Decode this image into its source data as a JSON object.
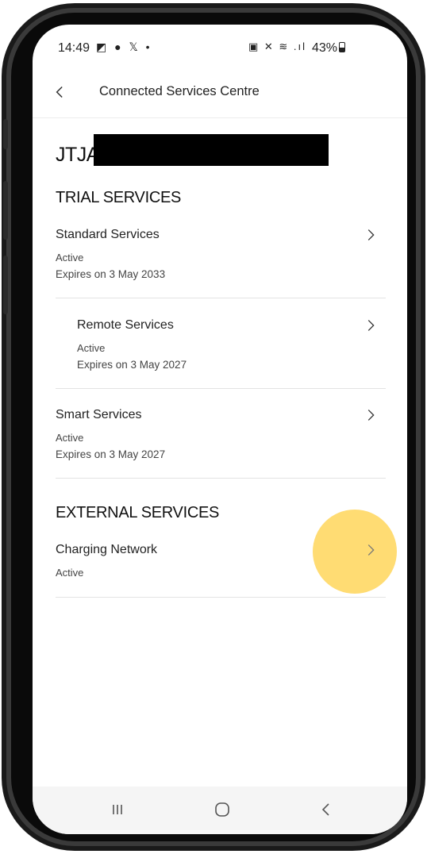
{
  "status_bar": {
    "time": "14:49",
    "left_icons": "◩ ● 𝕏 •",
    "right_icons": "▣ ✕ ≋ .ıl",
    "battery": "43%"
  },
  "header": {
    "title": "Connected Services Centre"
  },
  "vehicle": {
    "vin_prefix": "JTJA"
  },
  "trial_section": {
    "title": "TRIAL SERVICES",
    "items": [
      {
        "name": "Standard Services",
        "status": "Active",
        "expiry": "Expires on 3 May 2033"
      },
      {
        "name": "Remote Services",
        "status": "Active",
        "expiry": "Expires on 3 May 2027"
      },
      {
        "name": "Smart Services",
        "status": "Active",
        "expiry": "Expires on 3 May 2027"
      }
    ]
  },
  "external_section": {
    "title": "EXTERNAL SERVICES",
    "items": [
      {
        "name": "Charging Network",
        "status": "Active"
      }
    ]
  },
  "colors": {
    "highlight": "#FFD65A",
    "text": "#222222",
    "divider": "#E3E3E3"
  },
  "icons": {
    "back": "chevron-left-icon",
    "row": "chevron-right-icon",
    "nav_recents": "recents-icon",
    "nav_home": "home-icon",
    "nav_back": "back-icon"
  }
}
